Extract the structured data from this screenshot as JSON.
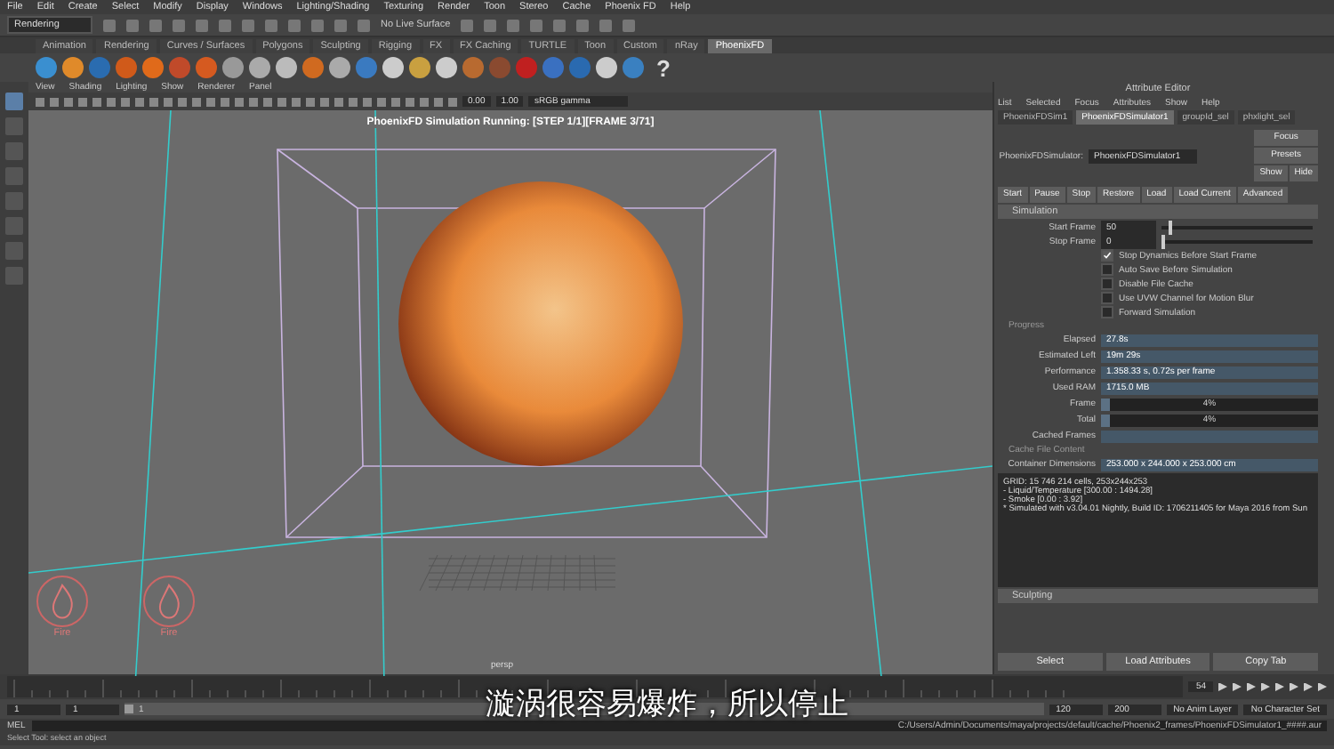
{
  "menu_bar": [
    "File",
    "Edit",
    "Create",
    "Select",
    "Modify",
    "Display",
    "Windows",
    "Lighting/Shading",
    "Texturing",
    "Render",
    "Toon",
    "Stereo",
    "Cache",
    "Phoenix FD",
    "Help"
  ],
  "status_line": {
    "mode": "Rendering",
    "live_surface": "No Live Surface"
  },
  "shelf_tabs": [
    {
      "label": "Animation",
      "selected": false
    },
    {
      "label": "Rendering",
      "selected": false
    },
    {
      "label": "Curves / Surfaces",
      "selected": false
    },
    {
      "label": "Polygons",
      "selected": false
    },
    {
      "label": "Sculpting",
      "selected": false
    },
    {
      "label": "Rigging",
      "selected": false
    },
    {
      "label": "FX",
      "selected": false
    },
    {
      "label": "FX Caching",
      "selected": false
    },
    {
      "label": "TURTLE",
      "selected": false
    },
    {
      "label": "Toon",
      "selected": false
    },
    {
      "label": "Custom",
      "selected": false
    },
    {
      "label": "nRay",
      "selected": false
    },
    {
      "label": "PhoenixFD",
      "selected": true
    }
  ],
  "shelf_help": "?",
  "viewport": {
    "menu": [
      "View",
      "Shading",
      "Lighting",
      "Show",
      "Renderer",
      "Panel"
    ],
    "exposure": "0.00",
    "gamma": "1.00",
    "color_space": "sRGB gamma",
    "status": "PhoenixFD Simulation Running: [STEP 1/1][FRAME 3/71]",
    "camera": "persp",
    "overlay_labels": [
      "Fire",
      "Fire"
    ]
  },
  "attribute_editor": {
    "title": "Attribute Editor",
    "menu": [
      "List",
      "Selected",
      "Focus",
      "Attributes",
      "Show",
      "Help"
    ],
    "tabs": [
      {
        "label": "PhoenixFDSim1",
        "selected": false
      },
      {
        "label": "PhoenixFDSimulator1",
        "selected": true
      },
      {
        "label": "groupId_sel",
        "selected": false
      },
      {
        "label": "phxlight_sel",
        "selected": false
      }
    ],
    "node_label": "PhoenixFDSimulator:",
    "node_name": "PhoenixFDSimulator1",
    "side_buttons": [
      "Focus",
      "Presets"
    ],
    "show_hide": [
      "Show",
      "Hide"
    ],
    "actions": [
      "Start",
      "Pause",
      "Stop",
      "Restore",
      "Load",
      "Load Current",
      "Advanced"
    ],
    "section": "Simulation",
    "frames": [
      {
        "label": "Start Frame",
        "value": "50",
        "level": 0.05
      },
      {
        "label": "Stop Frame",
        "value": "0",
        "level": 0.0
      }
    ],
    "options": [
      {
        "label": "Stop Dynamics Before Start Frame",
        "checked": true
      },
      {
        "label": "Auto Save Before Simulation",
        "checked": false
      },
      {
        "label": "Disable File Cache",
        "checked": false
      },
      {
        "label": "Use UVW Channel for Motion Blur",
        "checked": false
      },
      {
        "label": "Forward Simulation",
        "checked": false
      }
    ],
    "progress_heading": "Progress",
    "progress": [
      {
        "kind": "text",
        "label": "Elapsed",
        "value": "27.8s"
      },
      {
        "kind": "text",
        "label": "Estimated Left",
        "value": "19m 29s"
      },
      {
        "kind": "text",
        "label": "Performance",
        "value": "1.358.33 s, 0.72s per frame"
      },
      {
        "kind": "text",
        "label": "Used RAM",
        "value": "1715.0 MB"
      },
      {
        "kind": "bar",
        "label": "Frame",
        "value": "4%",
        "level": 0.04
      },
      {
        "kind": "bar",
        "label": "Total",
        "value": "4%",
        "level": 0.04
      },
      {
        "kind": "empty",
        "label": "Cached Frames"
      }
    ],
    "grid_heading": "Cache File Content",
    "container": {
      "label": "Container Dimensions",
      "value": "253.000 x 244.000 x 253.000 cm"
    },
    "log": [
      "GRID: 15 746 214 cells, 253x244x253",
      "- Liquid/Temperature [300.00 : 1494.28]",
      "- Smoke [0.00 : 3.92]",
      "* Simulated with v3.04.01 Nightly, Build ID: 1706211405 for Maya 2016 from Sun"
    ],
    "collapsed_section": "Sculpting",
    "bottom_buttons": [
      "Select",
      "Load Attributes",
      "Copy Tab"
    ]
  },
  "timeline": {
    "current_frame": "54",
    "range_slider": {
      "level": 0.0
    },
    "range": [
      "1",
      "1",
      "1",
      "120",
      "200"
    ],
    "anim_layer": "No Anim Layer",
    "character_set": "No Character Set"
  },
  "command_line": {
    "label": "MEL",
    "path": "C:/Users/Admin/Documents/maya/projects/default/cache/Phoenix2_frames/PhoenixFDSimulator1_####.aur"
  },
  "help_line": "Select Tool: select an object",
  "subtitle": "漩涡很容易爆炸，所以停止"
}
